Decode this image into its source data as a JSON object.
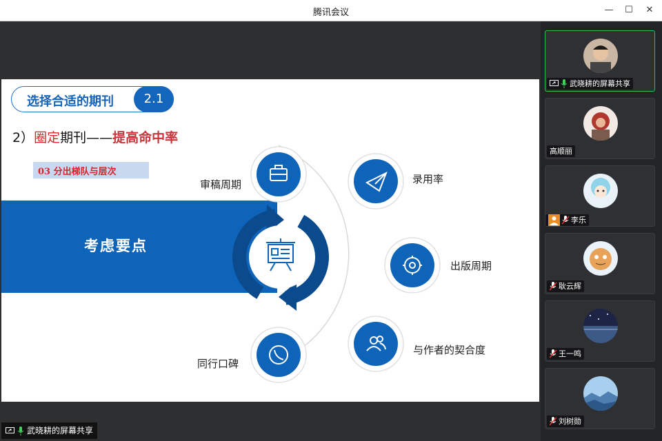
{
  "window": {
    "title": "腾讯会议",
    "minimize_glyph": "—",
    "maximize_glyph": "☐",
    "close_glyph": "✕"
  },
  "slide": {
    "section_label": "选择合适的期刊",
    "section_number": "2.1",
    "heading_prefix": "2）",
    "heading_red": "圈定",
    "heading_middle": "期刊——",
    "heading_strong": "提高命中率",
    "subtag": "03  分出梯队与层次",
    "band_text": "考虑要点",
    "nodes": [
      {
        "label": "审稿周期",
        "icon": "briefcase-icon"
      },
      {
        "label": "录用率",
        "icon": "paper-plane-icon"
      },
      {
        "label": "出版周期",
        "icon": "gear-icon"
      },
      {
        "label": "与作者的契合度",
        "icon": "users-icon"
      },
      {
        "label": "同行口碑",
        "icon": "phone-icon"
      }
    ],
    "center_icon": "presentation-board-icon",
    "colors": {
      "primary": "#1466bd",
      "dark": "#0b4a8c",
      "accent_red": "#d4262b"
    }
  },
  "participants": [
    {
      "name": "武晓耕的屏幕共享",
      "active": true,
      "mic": "on",
      "sharing": true
    },
    {
      "name": "高顺丽",
      "active": false,
      "mic": "none"
    },
    {
      "name": "李乐",
      "active": false,
      "mic": "muted",
      "host_badge": true
    },
    {
      "name": "耿云辉",
      "active": false,
      "mic": "muted"
    },
    {
      "name": "王一鸣",
      "active": false,
      "mic": "muted"
    },
    {
      "name": "刘树勋",
      "active": false,
      "mic": "muted"
    }
  ],
  "bottom_tag": {
    "text": "武晓耕的屏幕共享"
  }
}
